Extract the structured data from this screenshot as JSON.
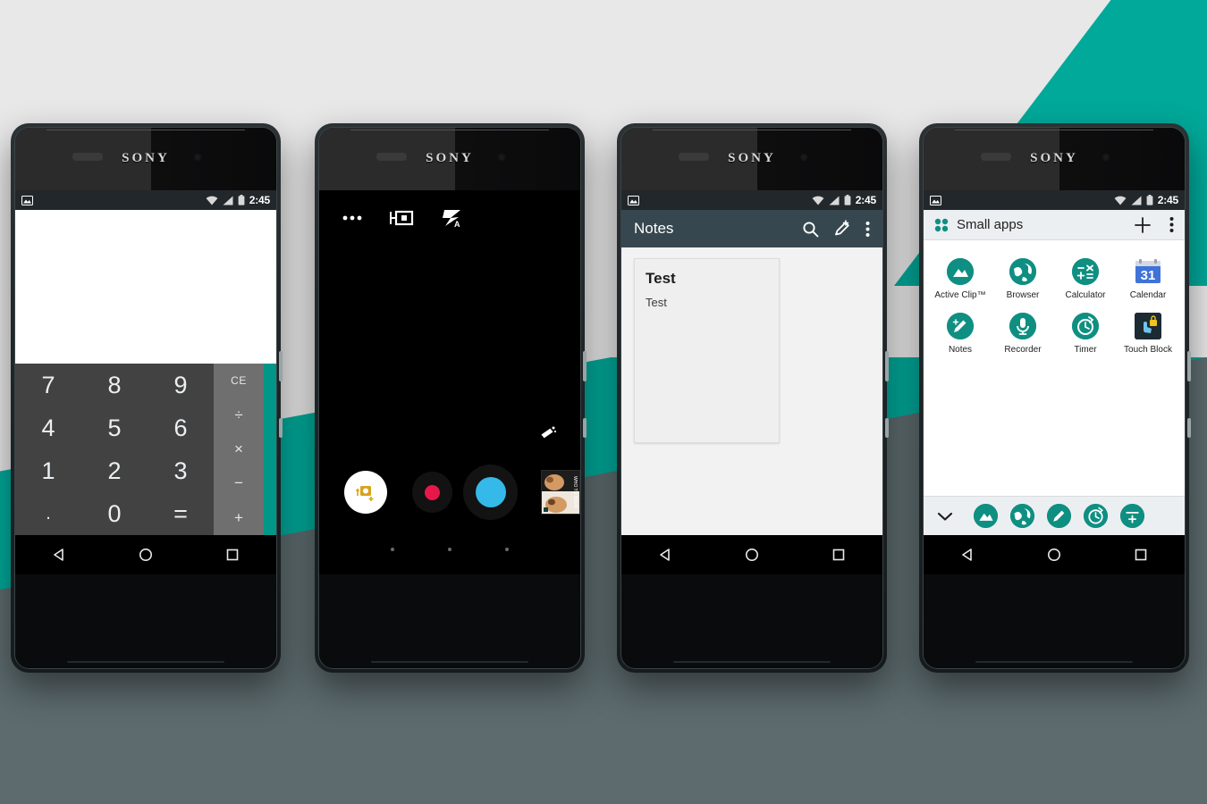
{
  "background": {
    "light": "#e8e8e8",
    "dark_slate": "#5d6b6e",
    "teal": "#00a99a"
  },
  "device": {
    "brand": "SONY",
    "count": 4
  },
  "status_bar": {
    "time": "2:45",
    "icons": [
      "image-icon",
      "wifi-icon",
      "signal-icon",
      "battery-icon"
    ]
  },
  "phones": [
    {
      "id": "calculator",
      "app": "Calculator",
      "display_value": "",
      "keys": [
        "7",
        "8",
        "9",
        "4",
        "5",
        "6",
        "1",
        "2",
        "3",
        ".",
        "0",
        "="
      ],
      "operators": [
        "CE",
        "÷",
        "×",
        "−",
        "+"
      ],
      "accent": "#009688"
    },
    {
      "id": "camera",
      "app": "Camera",
      "top_icons": [
        "more-options-icon",
        "exposure-icon",
        "flash-auto-icon"
      ],
      "settings_icon": "camera-settings-icon",
      "mode_button": "mode-selector-icon",
      "record_button": "record-button",
      "shutter_button": "shutter-button",
      "thumbnail_label": "WHO TO DRUK",
      "page_dots": 3
    },
    {
      "id": "notes",
      "app": "Notes",
      "title": "Notes",
      "actions": [
        "search-icon",
        "new-note-icon",
        "overflow-menu-icon"
      ],
      "note": {
        "title": "Test",
        "snippet": "Test"
      }
    },
    {
      "id": "small-apps",
      "app": "Small apps",
      "title": "Small apps",
      "header_icon": "small-apps-icon",
      "actions": [
        "add-icon",
        "overflow-menu-icon"
      ],
      "apps": [
        {
          "label": "Active Clip™",
          "icon": "active-clip-icon",
          "style": "round"
        },
        {
          "label": "Browser",
          "icon": "browser-icon",
          "style": "round"
        },
        {
          "label": "Calculator",
          "icon": "calculator-icon",
          "style": "round"
        },
        {
          "label": "Calendar",
          "icon": "calendar-icon",
          "style": "square",
          "day": "31"
        },
        {
          "label": "Notes",
          "icon": "notes-icon",
          "style": "round"
        },
        {
          "label": "Recorder",
          "icon": "recorder-icon",
          "style": "round"
        },
        {
          "label": "Timer",
          "icon": "timer-icon",
          "style": "round"
        },
        {
          "label": "Touch Block",
          "icon": "touch-block-icon",
          "style": "square"
        }
      ],
      "dock": {
        "collapse_icon": "chevron-down-icon",
        "items": [
          "active-clip-icon",
          "browser-icon",
          "notes-icon",
          "timer-icon",
          "add-icon"
        ]
      }
    }
  ],
  "nav_bar": {
    "back": "back-triangle-icon",
    "home": "home-circle-icon",
    "recents": "recents-square-icon"
  }
}
